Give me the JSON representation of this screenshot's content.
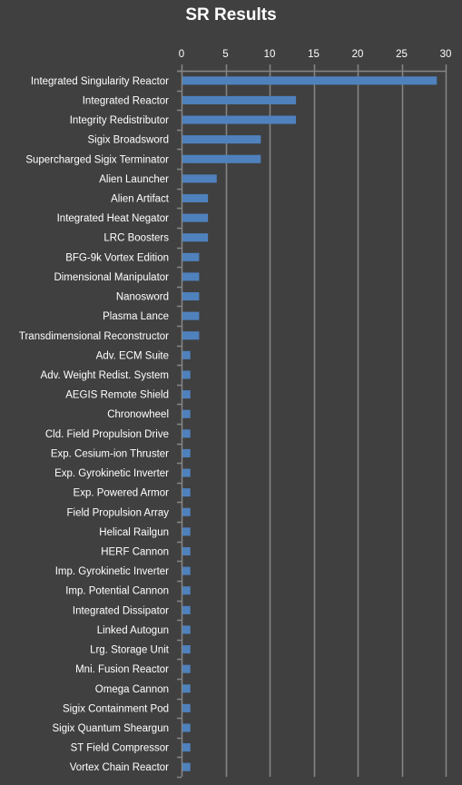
{
  "chart_data": {
    "type": "bar",
    "orientation": "horizontal",
    "title": "SR Results",
    "xlabel": "",
    "ylabel": "",
    "xlim": [
      0,
      30
    ],
    "x_ticks": [
      0,
      5,
      10,
      15,
      20,
      25,
      30
    ],
    "x_axis_position": "top",
    "grid": "vertical",
    "legend": "none",
    "bar_color": "#4f81bd",
    "background_color": "#404040",
    "gridline_color": "#868686",
    "categories": [
      "Integrated Singularity Reactor",
      "Integrated Reactor",
      "Integrity Redistributor",
      "Sigix Broadsword",
      "Supercharged Sigix Terminator",
      "Alien Launcher",
      "Alien Artifact",
      "Integrated Heat Negator",
      "LRC Boosters",
      "BFG-9k Vortex Edition",
      "Dimensional Manipulator",
      "Nanosword",
      "Plasma Lance",
      "Transdimensional Reconstructor",
      "Adv. ECM Suite",
      "Adv. Weight Redist. System",
      "AEGIS Remote Shield",
      "Chronowheel",
      "Cld. Field Propulsion Drive",
      "Exp. Cesium-ion Thruster",
      "Exp. Gyrokinetic Inverter",
      "Exp. Powered Armor",
      "Field Propulsion Array",
      "Helical Railgun",
      "HERF Cannon",
      "Imp. Gyrokinetic Inverter",
      "Imp. Potential Cannon",
      "Integrated Dissipator",
      "Linked Autogun",
      "Lrg. Storage Unit",
      "Mni. Fusion Reactor",
      "Omega Cannon",
      "Sigix Containment  Pod",
      "Sigix Quantum  Sheargun",
      "ST Field Compressor",
      "Vortex Chain  Reactor"
    ],
    "values": [
      29,
      13,
      13,
      9,
      9,
      4,
      3,
      3,
      3,
      2,
      2,
      2,
      2,
      2,
      1,
      1,
      1,
      1,
      1,
      1,
      1,
      1,
      1,
      1,
      1,
      1,
      1,
      1,
      1,
      1,
      1,
      1,
      1,
      1,
      1,
      1
    ]
  }
}
